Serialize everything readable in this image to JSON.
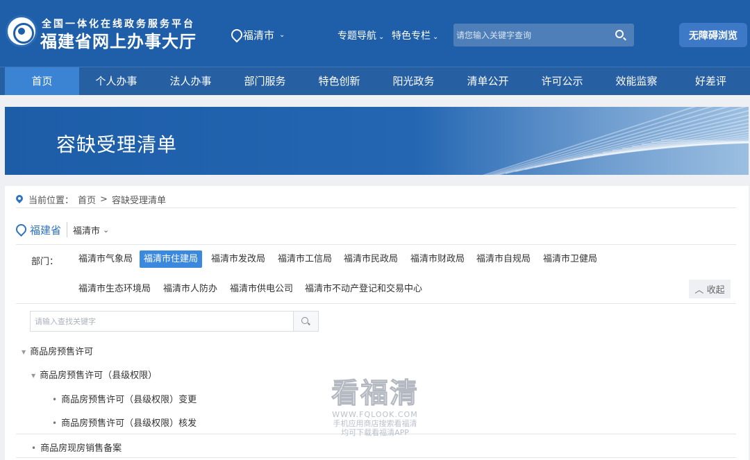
{
  "header": {
    "subtitle": "全国一体化在线政务服务平台",
    "title": "福建省网上办事大厅",
    "location": "福清市",
    "nav": [
      {
        "label": "专题导航"
      },
      {
        "label": "特色专栏"
      }
    ],
    "search_placeholder": "请您输入关键字查询",
    "accessibility_label": "无障碍浏览"
  },
  "mainnav": {
    "items": [
      "首页",
      "个人办事",
      "法人办事",
      "部门服务",
      "特色创新",
      "阳光政务",
      "清单公开",
      "许可公示",
      "效能监察",
      "好差评"
    ],
    "active_index": 0
  },
  "banner": {
    "title": "容缺受理清单"
  },
  "breadcrumb": {
    "label": "当前位置：",
    "home": "首页",
    "sep": ">",
    "current": "容缺受理清单"
  },
  "region": {
    "province": "福建省",
    "city": "福清市"
  },
  "departments": {
    "label": "部门：",
    "items": [
      "福清市气象局",
      "福清市住建局",
      "福清市发改局",
      "福清市工信局",
      "福清市民政局",
      "福清市财政局",
      "福清市自规局",
      "福清市卫健局",
      "福清市生态环境局",
      "福清市人防办",
      "福清市供电公司",
      "福清市不动产登记和交易中心"
    ],
    "active_index": 1,
    "collapse_label": "收起"
  },
  "keyword_search": {
    "placeholder": "请输入查找关键字"
  },
  "tree": [
    {
      "label": "商品房预售许可"
    },
    {
      "label": "商品房预售许可（县级权限）"
    },
    {
      "label": "商品房预售许可（县级权限）变更"
    },
    {
      "label": "商品房预售许可（县级权限）核发"
    },
    {
      "label": "商品房现房销售备案"
    }
  ],
  "watermark": {
    "big": "看福清",
    "url": "WWW.FQLOOK.COM",
    "line1": "手机应用商店搜索看福清",
    "line2": "均可下载看福清APP"
  },
  "colors": {
    "header_bg": "#1f5ea8",
    "nav_active": "#3b83d3",
    "dept_active": "#3b88df"
  }
}
